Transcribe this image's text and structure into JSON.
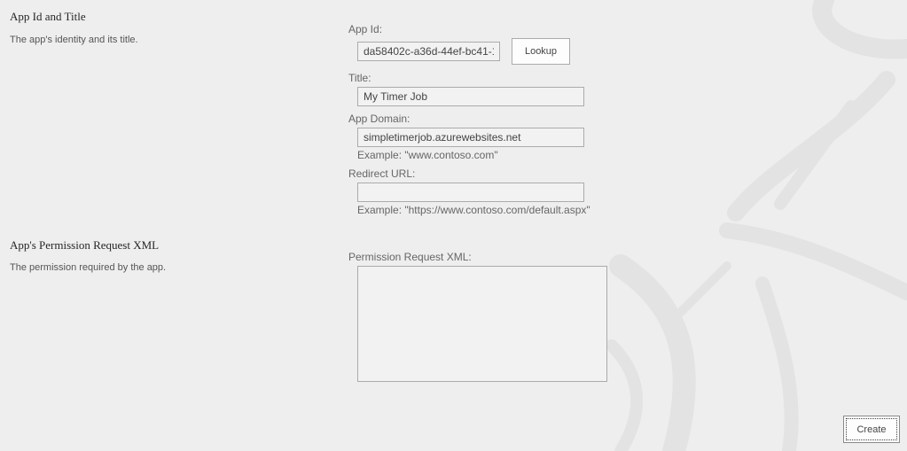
{
  "sections": {
    "identity": {
      "title": "App Id and Title",
      "description": "The app's identity and its title."
    },
    "permissions": {
      "title": "App's Permission Request XML",
      "description": "The permission required by the app."
    }
  },
  "fields": {
    "app_id": {
      "label": "App Id:",
      "value": "da58402c-a36d-44ef-bc41-1"
    },
    "lookup_button": "Lookup",
    "title": {
      "label": "Title:",
      "value": "My Timer Job"
    },
    "app_domain": {
      "label": "App Domain:",
      "value": "simpletimerjob.azurewebsites.net",
      "hint": "Example: \"www.contoso.com\""
    },
    "redirect_url": {
      "label": "Redirect URL:",
      "value": "",
      "hint": "Example: \"https://www.contoso.com/default.aspx\""
    },
    "permission_xml": {
      "label": "Permission Request XML:",
      "value": ""
    }
  },
  "create_button": "Create",
  "theme": {
    "background": "#eeeeee",
    "border": "#ababab",
    "text": "#444444"
  }
}
